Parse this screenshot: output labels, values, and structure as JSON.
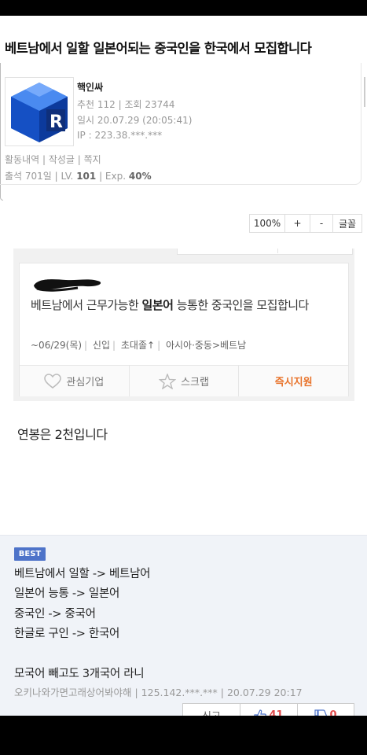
{
  "post": {
    "title": "베트남에서 일할 일본어되는 중국인을 한국에서 모집합니다",
    "author": {
      "name": "핵인싸",
      "recommend_views": "추천 112 | 조회 23744",
      "date": "일시 20.07.29 (20:05:41)",
      "ip": "IP : 223.38.***.***",
      "links": "활동내역 | 작성글 | 쪽지",
      "attendance": "출석 701일 | LV.",
      "level": "101",
      "exp_label": "| Exp.",
      "exp": "40%"
    },
    "font_toolbar": {
      "percent": "100%",
      "plus": "+",
      "minus": "-",
      "font": "글꼴"
    },
    "job_ad": {
      "title_pre": "베트남에서 근무가능한 ",
      "title_bold": "일본어",
      "title_post": " 능통한 중국인을 모집합니다",
      "deadline": "~06/29(목)",
      "career": "신입",
      "education": "초대졸↑",
      "location": "아시아·중동>베트남",
      "btn_interest": "관심기업",
      "btn_scrap": "스크랩",
      "btn_apply": "즉시지원"
    },
    "body": "연봉은 2천입니다"
  },
  "best_comment": {
    "badge": "BEST",
    "lines": [
      "베트남에서 일할 -> 베트남어",
      "일본어 능통 -> 일본어",
      "중국인 -> 중국어",
      "한글로 구인 -> 한국어",
      "모국어 빼고도 3개국어 라니"
    ],
    "meta": "오키나와가면고래상어봐야해 | 125.142.***.*** | 20.07.29 20:17",
    "report_label": "신고",
    "likes": "41",
    "dislikes": "0",
    "accent_color": "#4e73c9"
  }
}
